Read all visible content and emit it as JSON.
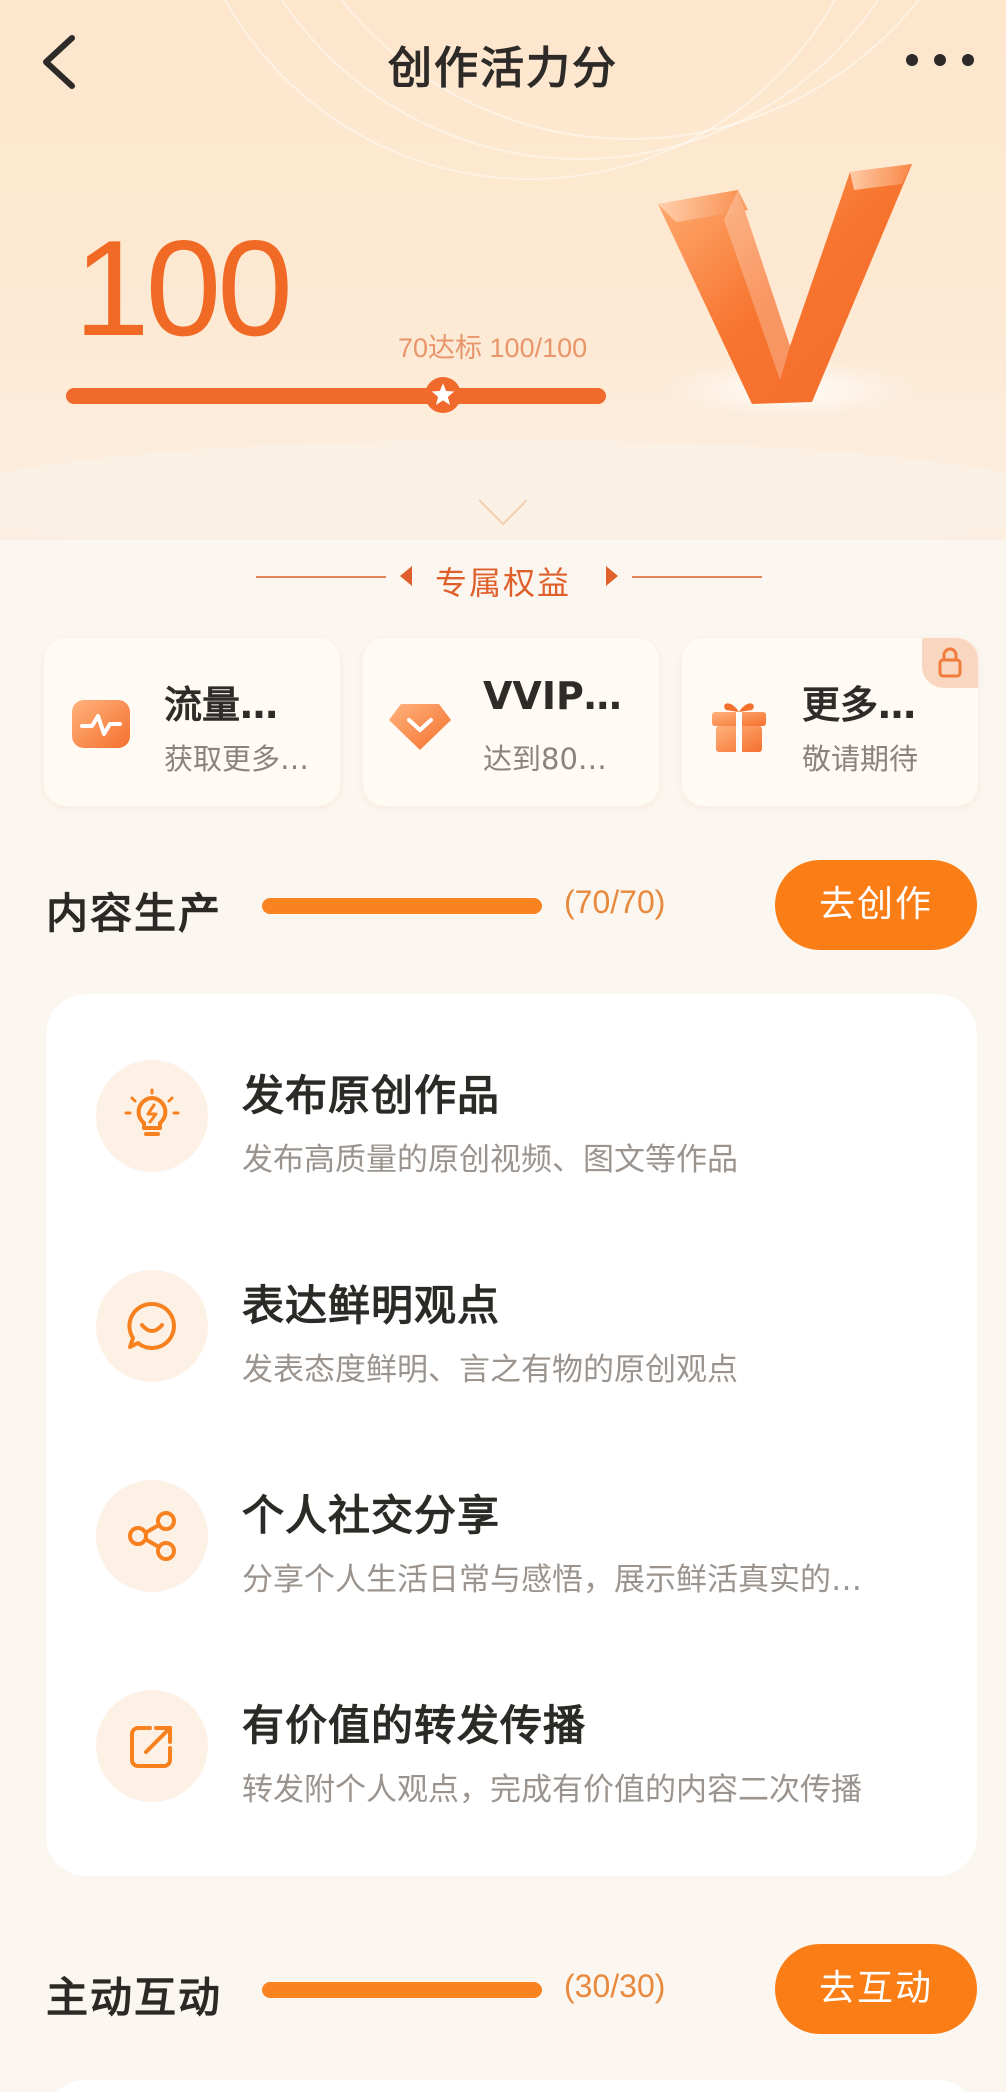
{
  "header": {
    "title": "创作活力分"
  },
  "score": {
    "value": "100",
    "note": "70达标 100/100",
    "progress_fraction": 1.0,
    "star_at_fraction": 0.7
  },
  "benefits": {
    "title": "专属权益",
    "items": [
      {
        "title": "流量…",
        "subtitle": "获取更多…",
        "icon": "traffic-pulse-icon",
        "locked": false
      },
      {
        "title": "VVIP…",
        "subtitle": "达到80…",
        "icon": "diamond-icon",
        "locked": false
      },
      {
        "title": "更多…",
        "subtitle": "敬请期待",
        "icon": "gift-icon",
        "locked": true
      }
    ]
  },
  "sections": [
    {
      "title": "内容生产",
      "count": "(70/70)",
      "progress_fraction": 1.0,
      "button": "去创作",
      "tasks": [
        {
          "title": "发布原创作品",
          "desc": "发布高质量的原创视频、图文等作品",
          "icon": "lightbulb-icon"
        },
        {
          "title": "表达鲜明观点",
          "desc": "发表态度鲜明、言之有物的原创观点",
          "icon": "smile-bubble-icon"
        },
        {
          "title": "个人社交分享",
          "desc": "分享个人生活日常与感悟，展示鲜活真实的…",
          "icon": "share-icon"
        },
        {
          "title": "有价值的转发传播",
          "desc": "转发附个人观点，完成有价值的内容二次传播",
          "icon": "forward-icon"
        }
      ]
    },
    {
      "title": "主动互动",
      "count": "(30/30)",
      "progress_fraction": 1.0,
      "button": "去互动"
    }
  ],
  "colors": {
    "accent": "#f06a25",
    "button": "#fa7d16",
    "background": "#fbf6f0"
  }
}
